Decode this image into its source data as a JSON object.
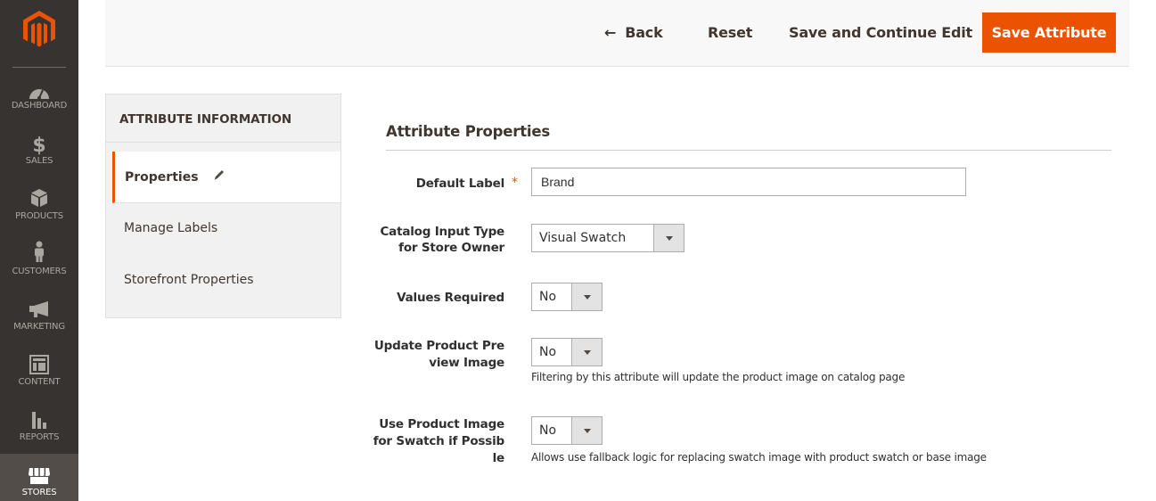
{
  "nav": {
    "logo": "magento-logo",
    "items": [
      {
        "label": "DASHBOARD",
        "icon": "dashboard-gauge-icon"
      },
      {
        "label": "SALES",
        "icon": "dollar-icon"
      },
      {
        "label": "PRODUCTS",
        "icon": "box-icon"
      },
      {
        "label": "CUSTOMERS",
        "icon": "person-icon"
      },
      {
        "label": "MARKETING",
        "icon": "megaphone-icon"
      },
      {
        "label": "CONTENT",
        "icon": "layout-icon"
      },
      {
        "label": "REPORTS",
        "icon": "bar-chart-icon"
      },
      {
        "label": "STORES",
        "icon": "storefront-icon",
        "active": true
      }
    ]
  },
  "actions": {
    "back_arrow": "←",
    "back": "Back",
    "reset": "Reset",
    "save_continue": "Save and Continue Edit",
    "save": "Save Attribute",
    "accent_color": "#eb5202"
  },
  "tabs": {
    "title": "ATTRIBUTE INFORMATION",
    "items": [
      {
        "label": "Properties",
        "active": true,
        "icon": "pencil-icon"
      },
      {
        "label": "Manage Labels"
      },
      {
        "label": "Storefront Properties"
      }
    ]
  },
  "form": {
    "section_title": "Attribute Properties",
    "required_mark": "*",
    "fields": {
      "default_label": {
        "label": "Default Label",
        "value": "Brand"
      },
      "input_type": {
        "label_line1": "Catalog Input Type",
        "label_line2": "for Store Owner",
        "value": "Visual Swatch"
      },
      "values_required": {
        "label": "Values Required",
        "value": "No"
      },
      "update_preview": {
        "label_line1": "Update Product Pre",
        "label_line2": "view Image",
        "value": "No",
        "note": "Filtering by this attribute will update the product image on catalog page"
      },
      "use_product_image": {
        "label_line1": "Use Product Image",
        "label_line2": "for Swatch if Possib",
        "label_line3": "le",
        "value": "No",
        "note": "Allows use fallback logic for replacing swatch image with product swatch or base image"
      }
    }
  }
}
